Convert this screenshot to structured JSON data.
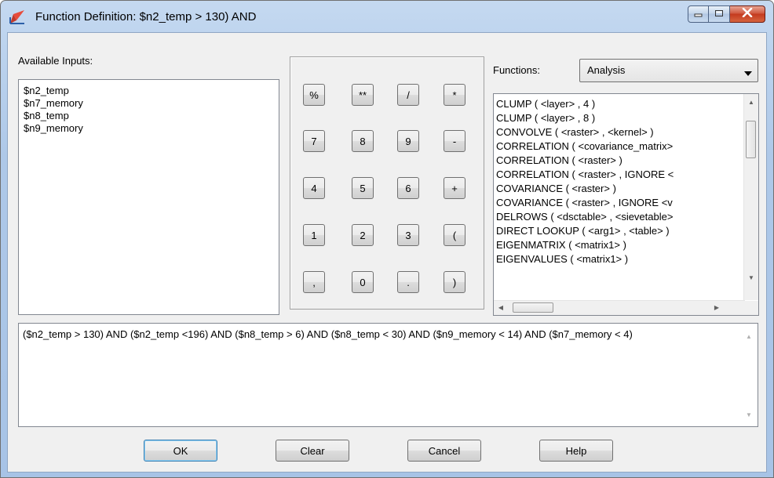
{
  "window": {
    "title": "Function Definition:  $n2_temp > 130) AND",
    "app_icon": "pen-tool-icon",
    "caption_buttons": [
      "minimize-icon",
      "maximize-icon",
      "close-icon"
    ]
  },
  "inputs": {
    "label": "Available Inputs:",
    "items": [
      "$n2_temp",
      "$n7_memory",
      "$n8_temp",
      "$n9_memory"
    ]
  },
  "keypad": {
    "rows": [
      [
        "%",
        "**",
        "/",
        "*"
      ],
      [
        "7",
        "8",
        "9",
        "-"
      ],
      [
        "4",
        "5",
        "6",
        "+"
      ],
      [
        "1",
        "2",
        "3",
        "("
      ],
      [
        ",",
        "0",
        ".",
        ")"
      ]
    ]
  },
  "functions": {
    "label": "Functions:",
    "selected_category": "Analysis",
    "items": [
      "CLUMP ( <layer> , 4 )",
      "CLUMP ( <layer> , 8 )",
      "CONVOLVE ( <raster> , <kernel> )",
      "CORRELATION ( <covariance_matrix>",
      "CORRELATION ( <raster> )",
      "CORRELATION ( <raster> , IGNORE <",
      "COVARIANCE ( <raster> )",
      "COVARIANCE ( <raster> , IGNORE <v",
      "DELROWS ( <dsctable> , <sievetable>",
      "DIRECT LOOKUP ( <arg1> , <table> )",
      "EIGENMATRIX ( <matrix1> )",
      "EIGENVALUES ( <matrix1> )"
    ]
  },
  "expression": {
    "text": "($n2_temp > 130) AND ($n2_temp <196) AND ($n8_temp > 6) AND  ($n8_temp < 30) AND ($n9_memory < 14) AND ($n7_memory < 4)"
  },
  "buttons": {
    "ok": "OK",
    "clear": "Clear",
    "cancel": "Cancel",
    "help": "Help"
  },
  "colors": {
    "title_gradient_top": "#c5d9f0",
    "close_button": "#c43a1e",
    "client_background": "#f0f0f0"
  }
}
